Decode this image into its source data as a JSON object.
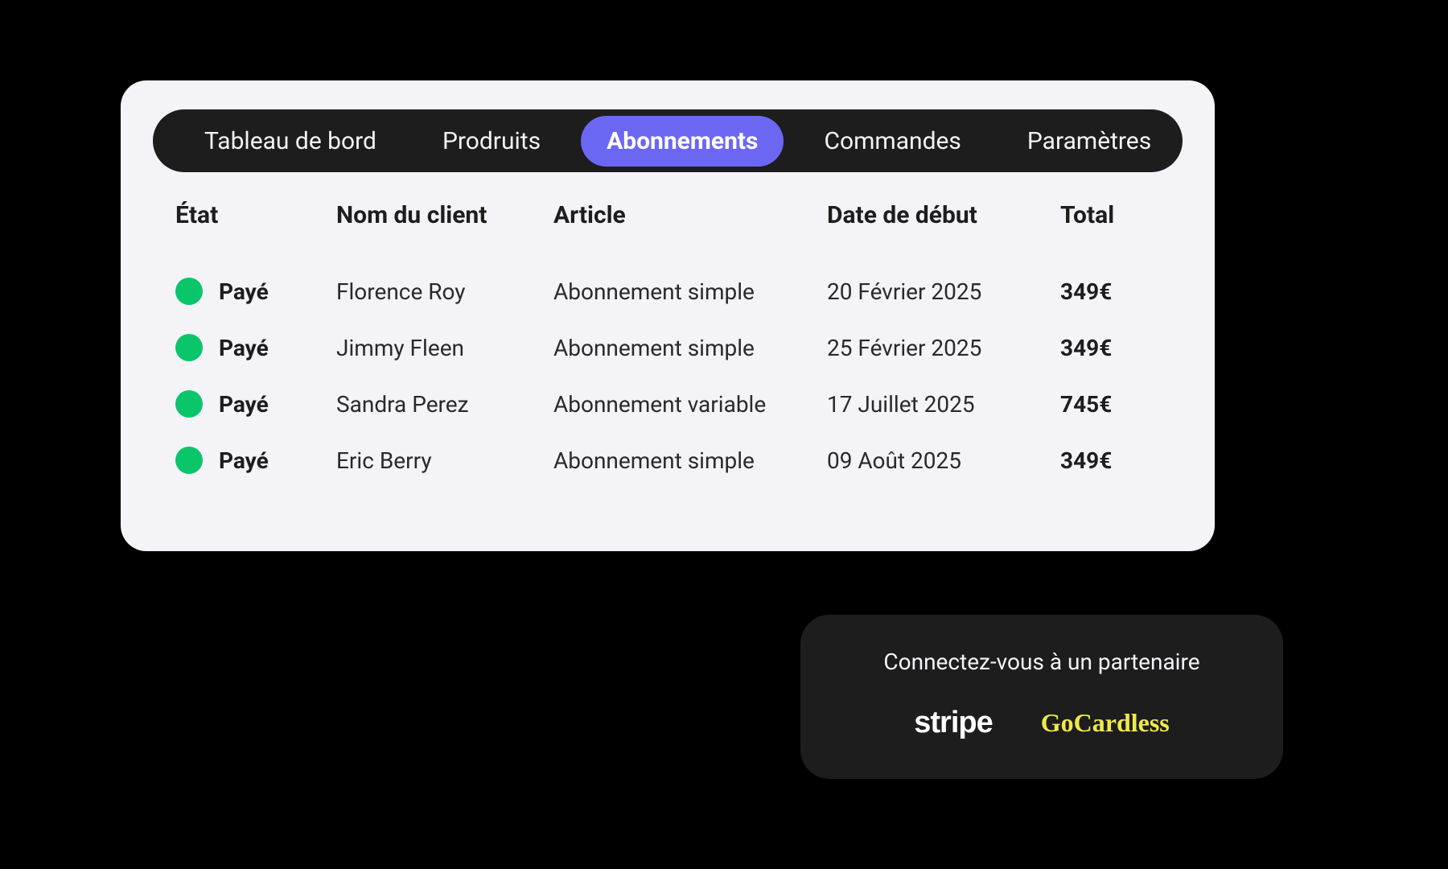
{
  "nav": {
    "items": [
      {
        "label": "Tableau de bord",
        "active": false
      },
      {
        "label": "Prodruits",
        "active": false
      },
      {
        "label": "Abonnements",
        "active": true
      },
      {
        "label": "Commandes",
        "active": false
      },
      {
        "label": "Paramètres",
        "active": false
      }
    ]
  },
  "table": {
    "headers": {
      "status": "État",
      "client": "Nom du client",
      "article": "Article",
      "start_date": "Date de début",
      "total": "Total"
    },
    "rows": [
      {
        "status": "Payé",
        "status_color": "#0bc56b",
        "client": "Florence Roy",
        "article": "Abonnement simple",
        "start_date": "20 Février 2025",
        "total": "349€"
      },
      {
        "status": "Payé",
        "status_color": "#0bc56b",
        "client": "Jimmy Fleen",
        "article": "Abonnement simple",
        "start_date": "25 Février 2025",
        "total": "349€"
      },
      {
        "status": "Payé",
        "status_color": "#0bc56b",
        "client": "Sandra Perez",
        "article": "Abonnement variable",
        "start_date": "17 Juillet 2025",
        "total": "745€"
      },
      {
        "status": "Payé",
        "status_color": "#0bc56b",
        "client": "Eric Berry",
        "article": "Abonnement simple",
        "start_date": "09 Août 2025",
        "total": "349€"
      }
    ]
  },
  "partner": {
    "title": "Connectez-vous à un partenaire",
    "logos": {
      "stripe": "stripe",
      "gocardless": "GoCardless"
    }
  }
}
